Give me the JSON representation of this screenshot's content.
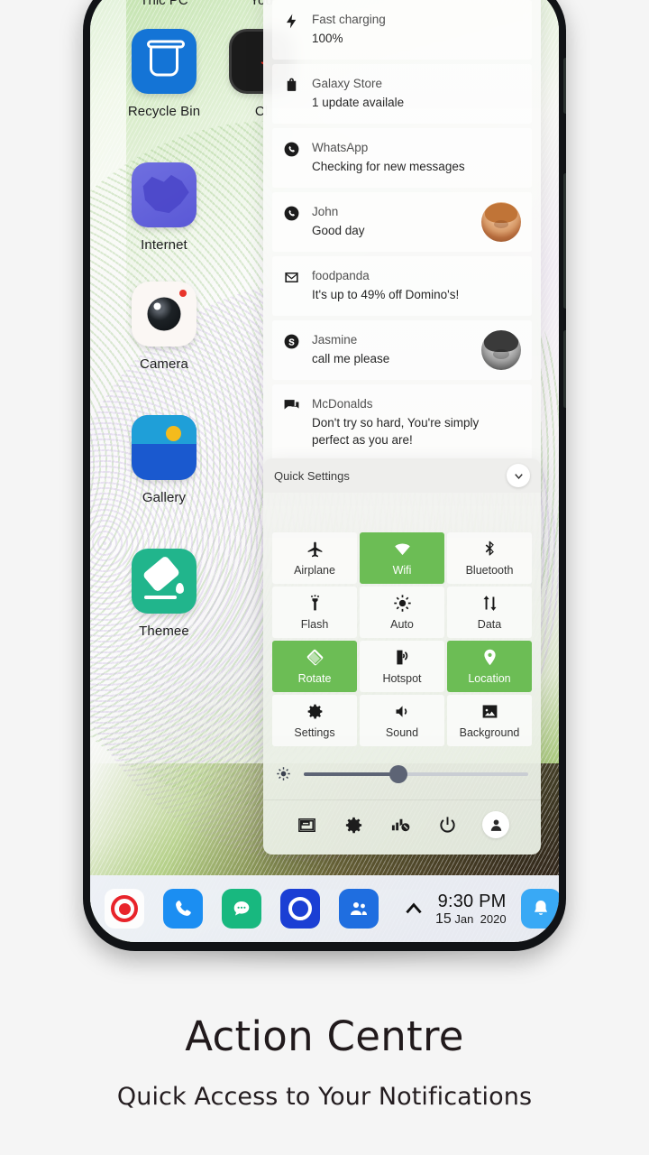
{
  "caption": {
    "title": "Action Centre",
    "subtitle": "Quick Access to Your Notifications"
  },
  "desktop": {
    "icons": [
      {
        "label": "Thic PC",
        "icon": "pc-icon",
        "label_position": "top"
      },
      {
        "label": "Recycle Bin",
        "icon": "recycle-bin-icon"
      },
      {
        "label": "Internet",
        "icon": "internet-icon"
      },
      {
        "label": "Camera",
        "icon": "camera-icon"
      },
      {
        "label": "Gallery",
        "icon": "gallery-icon"
      },
      {
        "label": "Themee",
        "icon": "theme-icon"
      },
      {
        "label": "You",
        "icon": "youtube-icon",
        "label_position": "top"
      },
      {
        "label": "Cl",
        "icon": "clock-icon"
      }
    ]
  },
  "notifications": [
    {
      "icon": "lightning-icon",
      "title": "Fast charging",
      "body": "100%",
      "avatar": "none"
    },
    {
      "icon": "bag-icon",
      "title": "Galaxy Store",
      "body": "1 update availale",
      "avatar": "none"
    },
    {
      "icon": "whatsapp-icon",
      "title": "WhatsApp",
      "body": "Checking for new messages",
      "avatar": "none"
    },
    {
      "icon": "whatsapp-icon",
      "title": "John",
      "body": "Good day",
      "avatar": "john"
    },
    {
      "icon": "gmail-icon",
      "title": "foodpanda",
      "body": "It's up to 49% off Domino's!",
      "avatar": "none"
    },
    {
      "icon": "skype-icon",
      "title": "Jasmine",
      "body": "call me please",
      "avatar": "jasmine"
    },
    {
      "icon": "chat-icon",
      "title": "McDonalds",
      "body": "Don't try so hard, You're simply perfect as you are!",
      "avatar": "none"
    }
  ],
  "quick_settings": {
    "header_title": "Quick Settings",
    "collapse_icon": "chevron-down-icon",
    "accent_on_color": "#6cbd55",
    "tiles": [
      {
        "label": "Airplane",
        "icon": "airplane-icon",
        "active": false
      },
      {
        "label": "Wifi",
        "icon": "wifi-icon",
        "active": true
      },
      {
        "label": "Bluetooth",
        "icon": "bluetooth-icon",
        "active": false
      },
      {
        "label": "Flash",
        "icon": "flashlight-icon",
        "active": false
      },
      {
        "label": "Auto",
        "icon": "brightness-auto-icon",
        "active": false
      },
      {
        "label": "Data",
        "icon": "data-icon",
        "active": false
      },
      {
        "label": "Rotate",
        "icon": "rotate-icon",
        "active": true
      },
      {
        "label": "Hotspot",
        "icon": "hotspot-icon",
        "active": false
      },
      {
        "label": "Location",
        "icon": "location-icon",
        "active": true
      },
      {
        "label": "Settings",
        "icon": "gear-icon",
        "active": false
      },
      {
        "label": "Sound",
        "icon": "sound-icon",
        "active": false
      },
      {
        "label": "Background",
        "icon": "image-icon",
        "active": false
      }
    ],
    "brightness": {
      "icon": "brightness-icon",
      "value_percent": 42
    },
    "action_bar": [
      {
        "icon": "screen-cast-icon"
      },
      {
        "icon": "gear-icon"
      },
      {
        "icon": "network-off-icon"
      },
      {
        "icon": "power-icon"
      },
      {
        "icon": "user-icon"
      }
    ]
  },
  "taskbar": {
    "apps": [
      {
        "icon": "record-icon"
      },
      {
        "icon": "phone-icon"
      },
      {
        "icon": "message-icon"
      },
      {
        "icon": "edge-icon"
      },
      {
        "icon": "teams-icon"
      }
    ],
    "expand_icon": "chevron-up-icon",
    "time": "9:30 PM",
    "date_day": "15",
    "date_month": "Jan",
    "date_year": "2020",
    "notification_icon": "bell-icon"
  }
}
